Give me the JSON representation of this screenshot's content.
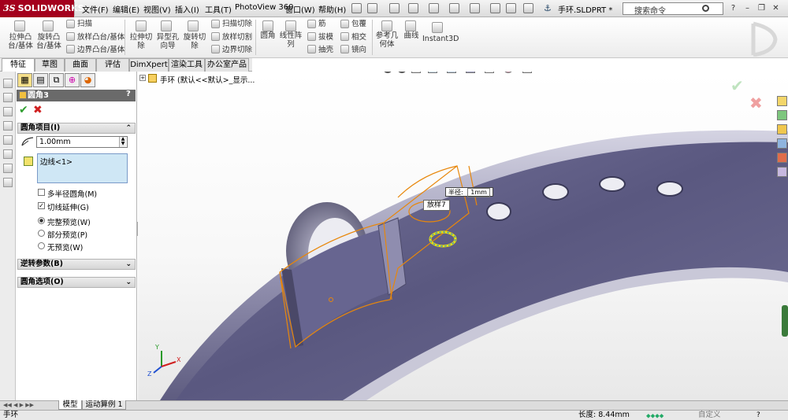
{
  "app": {
    "brand": "SOLIDWORKS",
    "brand_prefix": "3S"
  },
  "menu": [
    "文件(F)",
    "编辑(E)",
    "视图(V)",
    "插入(I)",
    "工具(T)",
    "PhotoView 360",
    "窗口(W)",
    "帮助(H)"
  ],
  "document_title": "手环.SLDPRT *",
  "search": {
    "placeholder": "搜索命令"
  },
  "commands": {
    "extrude_boss": "拉伸凸\n台/基体",
    "revolve_boss": "旋转凸\n台/基体",
    "sweep": "扫描",
    "loft_boss": "放样凸台/基体",
    "boundary_boss": "边界凸台/基体",
    "extrude_cut": "拉伸切\n除",
    "hole_wizard": "异型孔\n向导",
    "revolve_cut": "旋转切\n除",
    "sweep_cut": "扫描切除",
    "loft_cut": "放样切割",
    "boundary_cut": "边界切除",
    "fillet": "圆角",
    "linear_pattern": "线性阵\n列",
    "rib": "筋",
    "draft": "拔模",
    "shell": "抽壳",
    "wrap": "包覆",
    "intersect": "相交",
    "mirror": "镜向",
    "ref_geometry": "参考几\n何体",
    "curves": "曲线",
    "instant3d": "Instant3D"
  },
  "tabs": [
    "特征",
    "草图",
    "曲面",
    "评估",
    "DimXpert",
    "渲染工具",
    "办公室产品"
  ],
  "property_manager": {
    "title": "圆角3",
    "help": "?",
    "groups": {
      "fillet_items": "圆角项目(I)",
      "reverse_params": "逆转参数(B)",
      "fillet_options": "圆角选项(O)"
    },
    "radius_value": "1.00mm",
    "selection_item": "边线<1>",
    "checkboxes": [
      {
        "label": "多半径圆角(M)",
        "checked": false
      },
      {
        "label": "切线延伸(G)",
        "checked": true
      }
    ],
    "radios": [
      {
        "label": "完整预览(W)",
        "selected": true
      },
      {
        "label": "部分预览(P)",
        "selected": false
      },
      {
        "label": "无预览(W)",
        "selected": false
      }
    ]
  },
  "feature_tree": {
    "root_label": "手环 (默认<<默认>_显示..."
  },
  "viewport": {
    "callout_radius_label": "半径:",
    "callout_radius_value": "1mm",
    "callout_feature": "放样7"
  },
  "bottom_tabs": [
    "模型",
    "运动算例 1"
  ],
  "status": {
    "left": "手环",
    "measure": "长度: 8.44mm",
    "custom": "自定义"
  },
  "colors": {
    "brand": "#a4001d",
    "strap": "#5e5c80",
    "accent_orange": "#e8870b",
    "ok_green": "#2f9e2f",
    "cancel_red": "#d02020"
  }
}
